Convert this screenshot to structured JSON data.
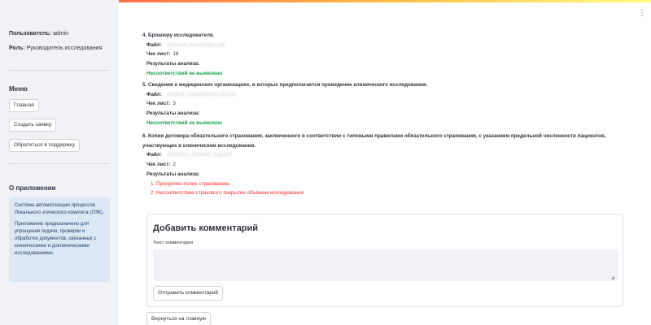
{
  "sidebar": {
    "user_label": "Пользователь:",
    "user_value": "admin",
    "role_label": "Роль:",
    "role_value": "Руководитель исследования",
    "menu_heading": "Меню",
    "menu_buttons": [
      "Главная",
      "Создать заявку",
      "Обратиться в поддержку"
    ],
    "about_heading": "О приложении",
    "about_text_1": "Система автоматизации процессов Локального этического комитета (ЛЭК).",
    "about_text_2": "Приложение предназначено для упрощения подачи, проверки и обработки документов, связанных с клиническими и доклиническими исследованиями."
  },
  "labels": {
    "file": "Файл:",
    "checklist": "Чек лист:",
    "results": "Результаты анализа:"
  },
  "items": [
    {
      "title": "4. Брошюру исследователя.",
      "file_name": "brochure_investigator.pdf",
      "checklist": "18",
      "result_ok": "Несоответствий не выявлено"
    },
    {
      "title": "5. Сведения о медицинских организациях, в которых предполагается проведение клинического исследования.",
      "file_name": "medical_organizations_list.pdf",
      "checklist": "3",
      "result_ok": "Несоответствий не выявлено"
    },
    {
      "title": "6. Копии договора обязательного страхования, заключенного в соответствии с типовыми правилами обязательного страхования, с указанием предельной численности пациентов, участвующих в клиническом исследовании.",
      "file_name": "insurance_contract_copy.pdf",
      "checklist": "2",
      "issues": [
        "1. Просрочен полис страхования.",
        "2. Несоответствие страхового покрытия объёмам исследования"
      ]
    }
  ],
  "comment": {
    "title": "Добавить комментарий",
    "field_label": "Текст комментария",
    "field_value": "",
    "submit_label": "Отправить комментарий"
  },
  "back_label": "Вернуться на главную",
  "colors": {
    "ok": "#18a34a",
    "error": "#ff2b2b",
    "sidebar_bg": "#f0f2f6",
    "info_bg": "#dce8f5"
  }
}
